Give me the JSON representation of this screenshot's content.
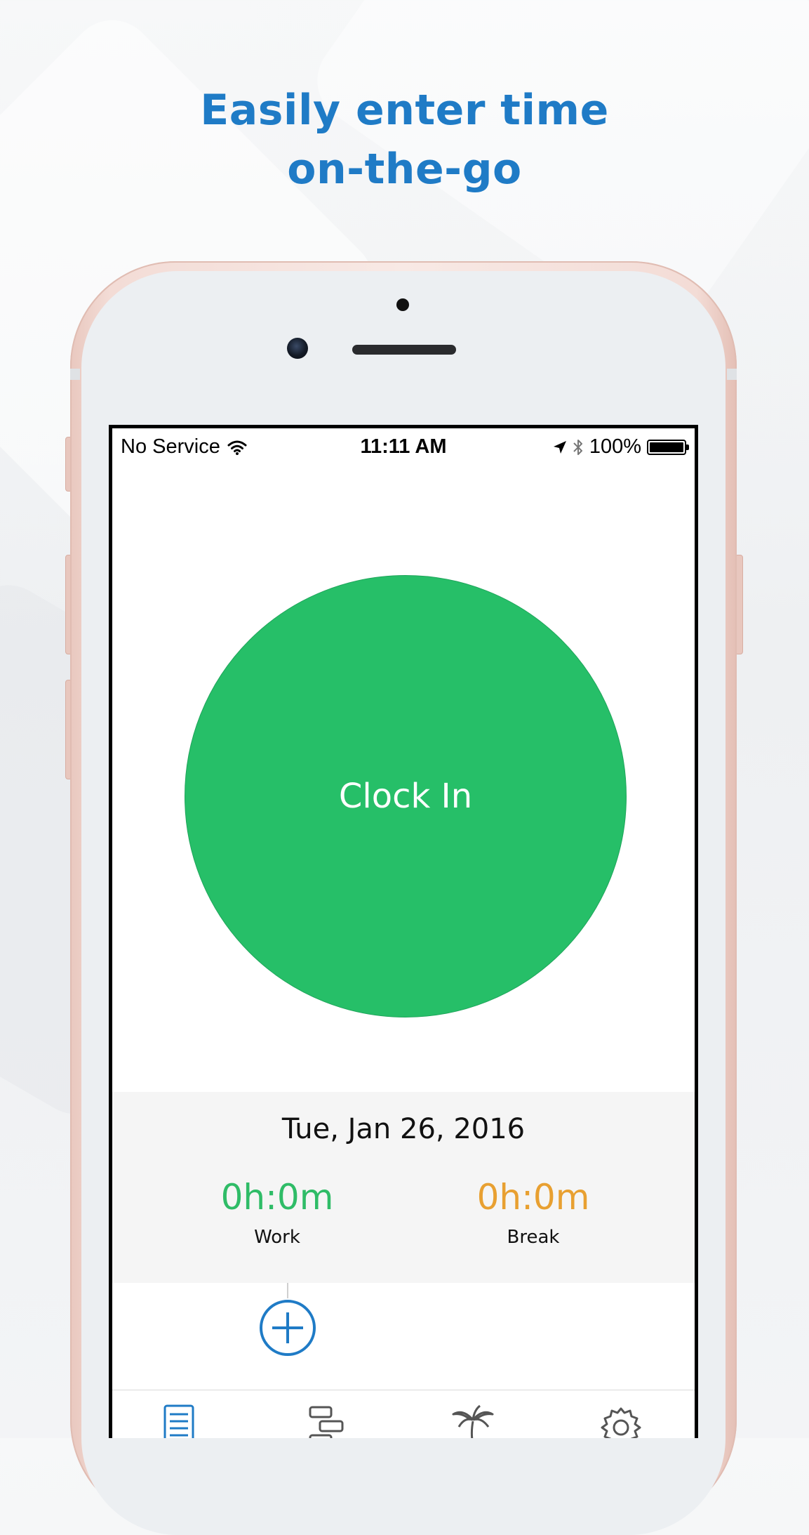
{
  "headline": {
    "line1": "Easily enter time",
    "line2": "on-the-go"
  },
  "status_bar": {
    "carrier": "No Service",
    "time": "11:11 AM",
    "battery": "100%",
    "icons": [
      "wifi-icon",
      "location-arrow-icon",
      "bluetooth-icon",
      "battery-icon"
    ]
  },
  "clock_button": {
    "label": "Clock In",
    "color": "#26bf68"
  },
  "summary": {
    "date": "Tue, Jan 26, 2016",
    "work": {
      "value": "0h:0m",
      "label": "Work",
      "color": "#2fbc67"
    },
    "break": {
      "value": "0h:0m",
      "label": "Break",
      "color": "#e8a031"
    }
  },
  "actions": {
    "add_icon": "plus-circle-icon",
    "accent": "#1f7bc6"
  },
  "tab_bar": {
    "tabs": [
      {
        "icon": "timesheet-icon",
        "active": true
      },
      {
        "icon": "schedule-icon",
        "active": false
      },
      {
        "icon": "time-off-icon",
        "active": false
      },
      {
        "icon": "settings-icon",
        "active": false
      }
    ]
  }
}
